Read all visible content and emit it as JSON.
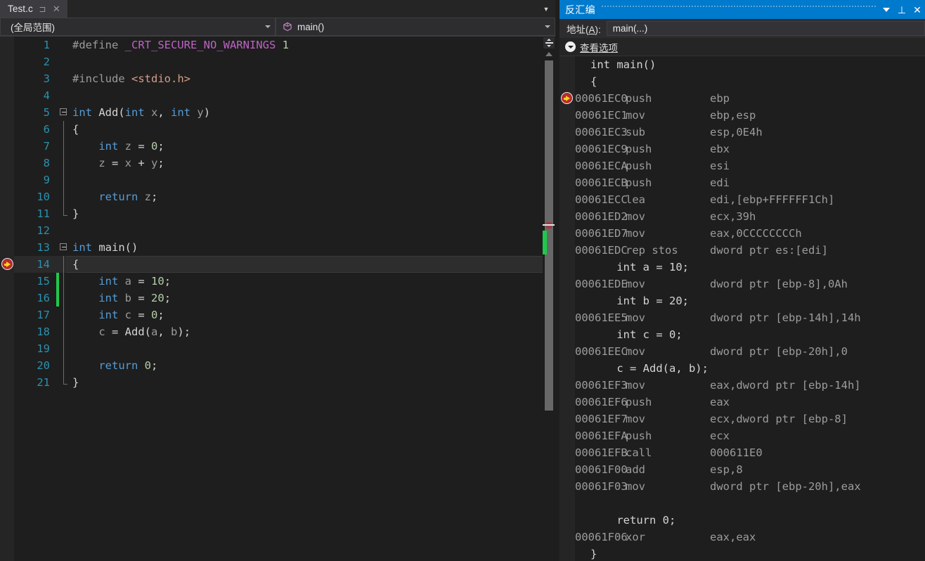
{
  "editor": {
    "tab": {
      "label": "Test.c",
      "pin_icon": "pin-icon",
      "close_icon": "close-icon"
    },
    "nav": {
      "scope": "(全局范围)",
      "member": "main()",
      "member_icon": "method-cube-icon"
    },
    "lines": [
      {
        "n": "1",
        "fold": "none",
        "chg": "",
        "tokens": [
          {
            "t": "#define ",
            "c": "t-pre"
          },
          {
            "t": "_CRT_SECURE_NO_WARNINGS",
            "c": "t-mac"
          },
          {
            "t": " ",
            "c": "t-pln"
          },
          {
            "t": "1",
            "c": "t-num"
          }
        ]
      },
      {
        "n": "2",
        "fold": "none",
        "chg": "",
        "tokens": []
      },
      {
        "n": "3",
        "fold": "none",
        "chg": "",
        "tokens": [
          {
            "t": "#include ",
            "c": "t-pre"
          },
          {
            "t": "<stdio.h>",
            "c": "t-str"
          }
        ]
      },
      {
        "n": "4",
        "fold": "none",
        "chg": "",
        "tokens": []
      },
      {
        "n": "5",
        "fold": "box",
        "chg": "",
        "tokens": [
          {
            "t": "int",
            "c": "t-kw"
          },
          {
            "t": " ",
            "c": "t-pln"
          },
          {
            "t": "Add",
            "c": "t-pln"
          },
          {
            "t": "(",
            "c": "t-punc"
          },
          {
            "t": "int",
            "c": "t-kw"
          },
          {
            "t": " ",
            "c": "t-pln"
          },
          {
            "t": "x",
            "c": "t-var"
          },
          {
            "t": ", ",
            "c": "t-punc"
          },
          {
            "t": "int",
            "c": "t-kw"
          },
          {
            "t": " ",
            "c": "t-pln"
          },
          {
            "t": "y",
            "c": "t-var"
          },
          {
            "t": ")",
            "c": "t-punc"
          }
        ]
      },
      {
        "n": "6",
        "fold": "line",
        "chg": "",
        "tokens": [
          {
            "t": "{",
            "c": "t-pln"
          }
        ]
      },
      {
        "n": "7",
        "fold": "line",
        "chg": "",
        "tokens": [
          {
            "t": "    ",
            "c": "t-pln"
          },
          {
            "t": "int",
            "c": "t-kw"
          },
          {
            "t": " ",
            "c": "t-pln"
          },
          {
            "t": "z",
            "c": "t-var"
          },
          {
            "t": " = ",
            "c": "t-punc"
          },
          {
            "t": "0",
            "c": "t-num"
          },
          {
            "t": ";",
            "c": "t-punc"
          }
        ]
      },
      {
        "n": "8",
        "fold": "line",
        "chg": "",
        "tokens": [
          {
            "t": "    ",
            "c": "t-pln"
          },
          {
            "t": "z",
            "c": "t-var"
          },
          {
            "t": " = ",
            "c": "t-punc"
          },
          {
            "t": "x",
            "c": "t-var"
          },
          {
            "t": " + ",
            "c": "t-punc"
          },
          {
            "t": "y",
            "c": "t-var"
          },
          {
            "t": ";",
            "c": "t-punc"
          }
        ]
      },
      {
        "n": "9",
        "fold": "line",
        "chg": "",
        "tokens": []
      },
      {
        "n": "10",
        "fold": "line",
        "chg": "",
        "tokens": [
          {
            "t": "    ",
            "c": "t-pln"
          },
          {
            "t": "return",
            "c": "t-kw"
          },
          {
            "t": " ",
            "c": "t-pln"
          },
          {
            "t": "z",
            "c": "t-var"
          },
          {
            "t": ";",
            "c": "t-punc"
          }
        ]
      },
      {
        "n": "11",
        "fold": "end",
        "chg": "",
        "tokens": [
          {
            "t": "}",
            "c": "t-pln"
          }
        ]
      },
      {
        "n": "12",
        "fold": "none",
        "chg": "",
        "tokens": []
      },
      {
        "n": "13",
        "fold": "box",
        "chg": "",
        "tokens": [
          {
            "t": "int",
            "c": "t-kw"
          },
          {
            "t": " ",
            "c": "t-pln"
          },
          {
            "t": "main",
            "c": "t-pln"
          },
          {
            "t": "()",
            "c": "t-punc"
          }
        ]
      },
      {
        "n": "14",
        "fold": "line",
        "chg": "",
        "highlight": true,
        "exec": true,
        "tokens": [
          {
            "t": "{",
            "c": "t-pln"
          }
        ]
      },
      {
        "n": "15",
        "fold": "line",
        "chg": "green",
        "tokens": [
          {
            "t": "    ",
            "c": "t-pln"
          },
          {
            "t": "int",
            "c": "t-kw"
          },
          {
            "t": " ",
            "c": "t-pln"
          },
          {
            "t": "a",
            "c": "t-var"
          },
          {
            "t": " = ",
            "c": "t-punc"
          },
          {
            "t": "10",
            "c": "t-num"
          },
          {
            "t": ";",
            "c": "t-punc"
          }
        ]
      },
      {
        "n": "16",
        "fold": "line",
        "chg": "green",
        "tokens": [
          {
            "t": "    ",
            "c": "t-pln"
          },
          {
            "t": "int",
            "c": "t-kw"
          },
          {
            "t": " ",
            "c": "t-pln"
          },
          {
            "t": "b",
            "c": "t-var"
          },
          {
            "t": " = ",
            "c": "t-punc"
          },
          {
            "t": "20",
            "c": "t-num"
          },
          {
            "t": ";",
            "c": "t-punc"
          }
        ]
      },
      {
        "n": "17",
        "fold": "line",
        "chg": "",
        "tokens": [
          {
            "t": "    ",
            "c": "t-pln"
          },
          {
            "t": "int",
            "c": "t-kw"
          },
          {
            "t": " ",
            "c": "t-pln"
          },
          {
            "t": "c",
            "c": "t-var"
          },
          {
            "t": " = ",
            "c": "t-punc"
          },
          {
            "t": "0",
            "c": "t-num"
          },
          {
            "t": ";",
            "c": "t-punc"
          }
        ]
      },
      {
        "n": "18",
        "fold": "line",
        "chg": "",
        "tokens": [
          {
            "t": "    ",
            "c": "t-pln"
          },
          {
            "t": "c",
            "c": "t-var"
          },
          {
            "t": " = ",
            "c": "t-punc"
          },
          {
            "t": "Add",
            "c": "t-pln"
          },
          {
            "t": "(",
            "c": "t-punc"
          },
          {
            "t": "a",
            "c": "t-var"
          },
          {
            "t": ", ",
            "c": "t-punc"
          },
          {
            "t": "b",
            "c": "t-var"
          },
          {
            "t": ");",
            "c": "t-punc"
          }
        ]
      },
      {
        "n": "19",
        "fold": "line",
        "chg": "",
        "tokens": []
      },
      {
        "n": "20",
        "fold": "line",
        "chg": "",
        "tokens": [
          {
            "t": "    ",
            "c": "t-pln"
          },
          {
            "t": "return",
            "c": "t-kw"
          },
          {
            "t": " ",
            "c": "t-pln"
          },
          {
            "t": "0",
            "c": "t-num"
          },
          {
            "t": ";",
            "c": "t-punc"
          }
        ]
      },
      {
        "n": "21",
        "fold": "end",
        "chg": "",
        "tokens": [
          {
            "t": "}",
            "c": "t-pln"
          }
        ]
      }
    ]
  },
  "disassembly": {
    "title": "反汇编",
    "address_label_pre": "地址(",
    "address_label_key": "A",
    "address_label_post": "):",
    "address_value": "main(...)",
    "view_options_label": "查看选项",
    "caret_icon": "chevron-down-icon",
    "pin_icon": "pin-icon",
    "close_icon": "close-icon",
    "expander_icon": "chevron-down-circle-icon",
    "rows": [
      {
        "type": "src",
        "text": "int main()"
      },
      {
        "type": "src",
        "text": "{"
      },
      {
        "type": "asm",
        "exec": true,
        "addr": "00061EC0",
        "mn": "push",
        "ops": "ebp"
      },
      {
        "type": "asm",
        "addr": "00061EC1",
        "mn": "mov",
        "ops": "ebp,esp"
      },
      {
        "type": "asm",
        "addr": "00061EC3",
        "mn": "sub",
        "ops": "esp,0E4h"
      },
      {
        "type": "asm",
        "addr": "00061EC9",
        "mn": "push",
        "ops": "ebx"
      },
      {
        "type": "asm",
        "addr": "00061ECA",
        "mn": "push",
        "ops": "esi"
      },
      {
        "type": "asm",
        "addr": "00061ECB",
        "mn": "push",
        "ops": "edi"
      },
      {
        "type": "asm",
        "addr": "00061ECC",
        "mn": "lea",
        "ops": "edi,[ebp+FFFFFF1Ch]"
      },
      {
        "type": "asm",
        "addr": "00061ED2",
        "mn": "mov",
        "ops": "ecx,39h"
      },
      {
        "type": "asm",
        "addr": "00061ED7",
        "mn": "mov",
        "ops": "eax,0CCCCCCCCh"
      },
      {
        "type": "asm",
        "addr": "00061EDC",
        "mn": "rep stos",
        "ops": "dword ptr es:[edi]"
      },
      {
        "type": "src",
        "text": "    int a = 10;"
      },
      {
        "type": "asm",
        "addr": "00061EDE",
        "mn": "mov",
        "ops": "dword ptr [ebp-8],0Ah"
      },
      {
        "type": "src",
        "text": "    int b = 20;"
      },
      {
        "type": "asm",
        "addr": "00061EE5",
        "mn": "mov",
        "ops": "dword ptr [ebp-14h],14h"
      },
      {
        "type": "src",
        "text": "    int c = 0;"
      },
      {
        "type": "asm",
        "addr": "00061EEC",
        "mn": "mov",
        "ops": "dword ptr [ebp-20h],0"
      },
      {
        "type": "src",
        "text": "    c = Add(a, b);"
      },
      {
        "type": "asm",
        "addr": "00061EF3",
        "mn": "mov",
        "ops": "eax,dword ptr [ebp-14h]"
      },
      {
        "type": "asm",
        "addr": "00061EF6",
        "mn": "push",
        "ops": "eax"
      },
      {
        "type": "asm",
        "addr": "00061EF7",
        "mn": "mov",
        "ops": "ecx,dword ptr [ebp-8]"
      },
      {
        "type": "asm",
        "addr": "00061EFA",
        "mn": "push",
        "ops": "ecx"
      },
      {
        "type": "asm",
        "addr": "00061EFB",
        "mn": "call",
        "ops": "000611E0"
      },
      {
        "type": "asm",
        "addr": "00061F00",
        "mn": "add",
        "ops": "esp,8"
      },
      {
        "type": "asm",
        "addr": "00061F03",
        "mn": "mov",
        "ops": "dword ptr [ebp-20h],eax"
      },
      {
        "type": "blank",
        "text": ""
      },
      {
        "type": "src",
        "text": "    return 0;"
      },
      {
        "type": "asm",
        "addr": "00061F06",
        "mn": "xor",
        "ops": "eax,eax"
      },
      {
        "type": "src",
        "text": "}"
      }
    ]
  },
  "colors": {
    "accent_blue": "#007acc",
    "editor_bg": "#1e1e1e",
    "chrome_bg": "#2d2d30",
    "line_number": "#2b91af",
    "keyword": "#569cd6",
    "number": "#b5cea8",
    "macro": "#bd63c5",
    "string": "#d69d85",
    "change_bar_green": "#1ec94a",
    "exec_marker_red": "#b52b2b",
    "exec_marker_yellow": "#ffd21e"
  }
}
